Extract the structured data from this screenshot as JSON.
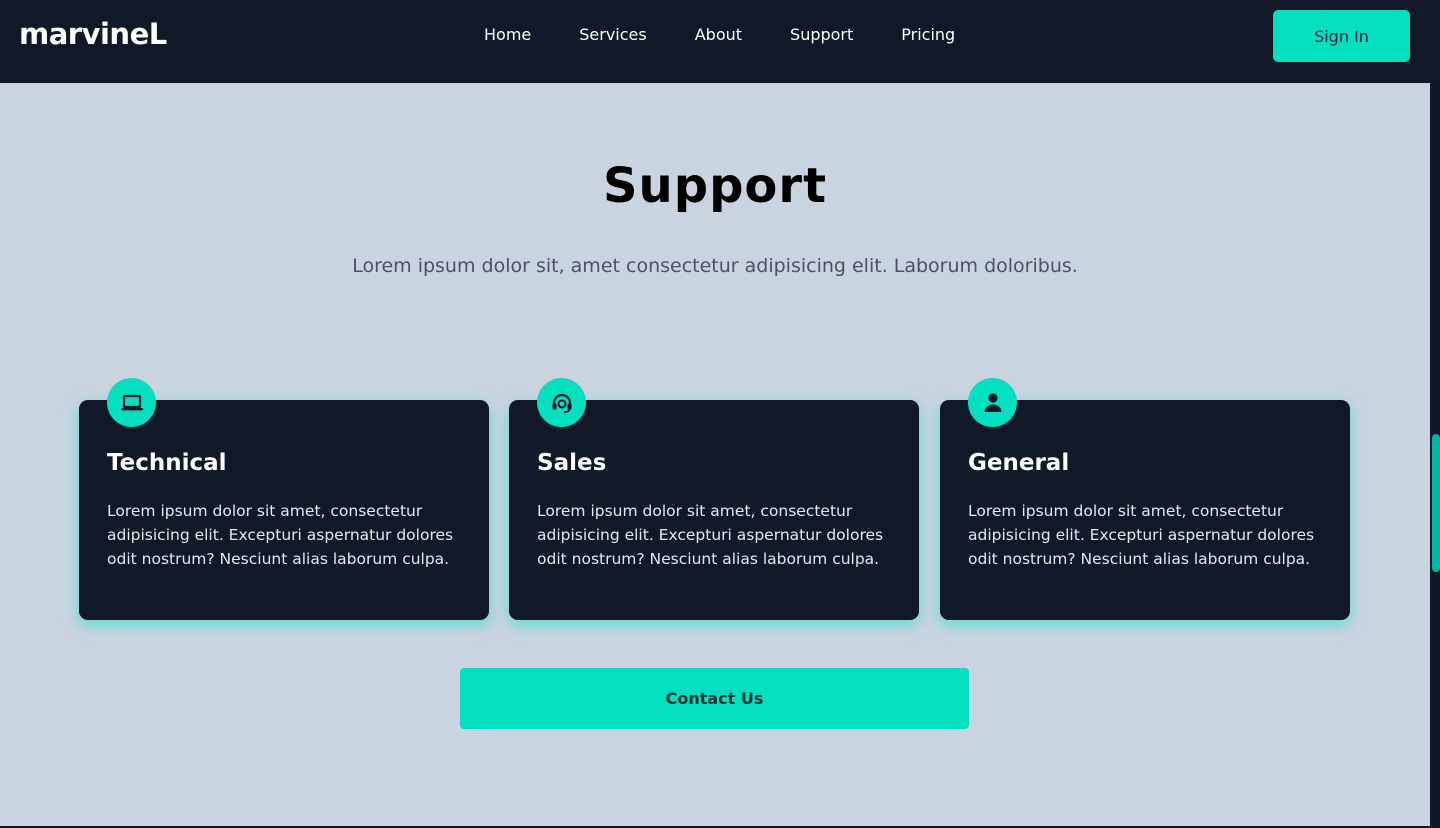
{
  "navbar": {
    "brand": "marvineL",
    "links": [
      {
        "label": "Home"
      },
      {
        "label": "Services"
      },
      {
        "label": "About"
      },
      {
        "label": "Support"
      },
      {
        "label": "Pricing"
      }
    ],
    "signin_label": "Sign In"
  },
  "main": {
    "title": "Support",
    "subtitle": "Lorem ipsum dolor sit, amet consectetur adipisicing elit. Laborum doloribus.",
    "cards": [
      {
        "icon": "laptop-icon",
        "title": "Technical",
        "text": "Lorem ipsum dolor sit amet, consectetur adipisicing elit. Excepturi aspernatur dolores odit nostrum? Nesciunt alias laborum culpa."
      },
      {
        "icon": "headset-icon",
        "title": "Sales",
        "text": "Lorem ipsum dolor sit amet, consectetur adipisicing elit. Excepturi aspernatur dolores odit nostrum? Nesciunt alias laborum culpa."
      },
      {
        "icon": "user-icon",
        "title": "General",
        "text": "Lorem ipsum dolor sit amet, consectetur adipisicing elit. Excepturi aspernatur dolores odit nostrum? Nesciunt alias laborum culpa."
      }
    ],
    "contact_label": "Contact Us"
  },
  "colors": {
    "navbar_bg": "#111827",
    "accent": "#04dfc0",
    "page_bg": "#cad4e0",
    "card_bg": "#111827"
  }
}
